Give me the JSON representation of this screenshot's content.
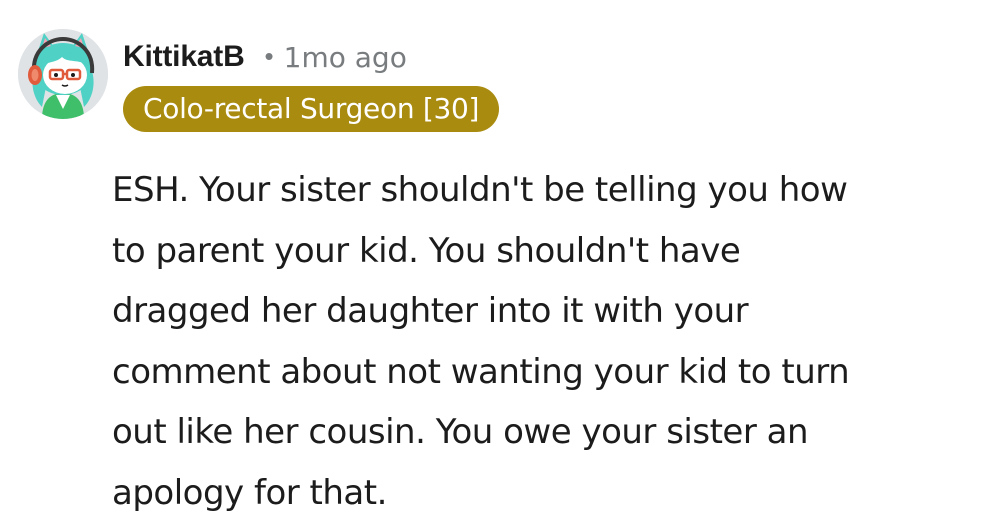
{
  "comment": {
    "username": "KittikatB",
    "separator": "•",
    "timestamp": "1mo ago",
    "flair": "Colo-rectal Surgeon [30]",
    "body_lines": [
      "ESH. Your sister shouldn't be telling you how",
      "to parent your kid. You shouldn't have",
      "dragged her daughter into it with your",
      "comment about not wanting your kid to turn",
      "out like her cousin. You owe your sister an",
      "apology for that."
    ]
  },
  "colors": {
    "flair_background": "#a98b0f",
    "flair_text": "#ffffff",
    "username_text": "#1c1c1c",
    "meta_text": "#787c7e",
    "body_text": "#1c1c1c",
    "avatar_hair": "#4fd1c5",
    "avatar_headphones": "#e05a3c"
  },
  "icons": {
    "avatar": "snoo-avatar-icon"
  }
}
